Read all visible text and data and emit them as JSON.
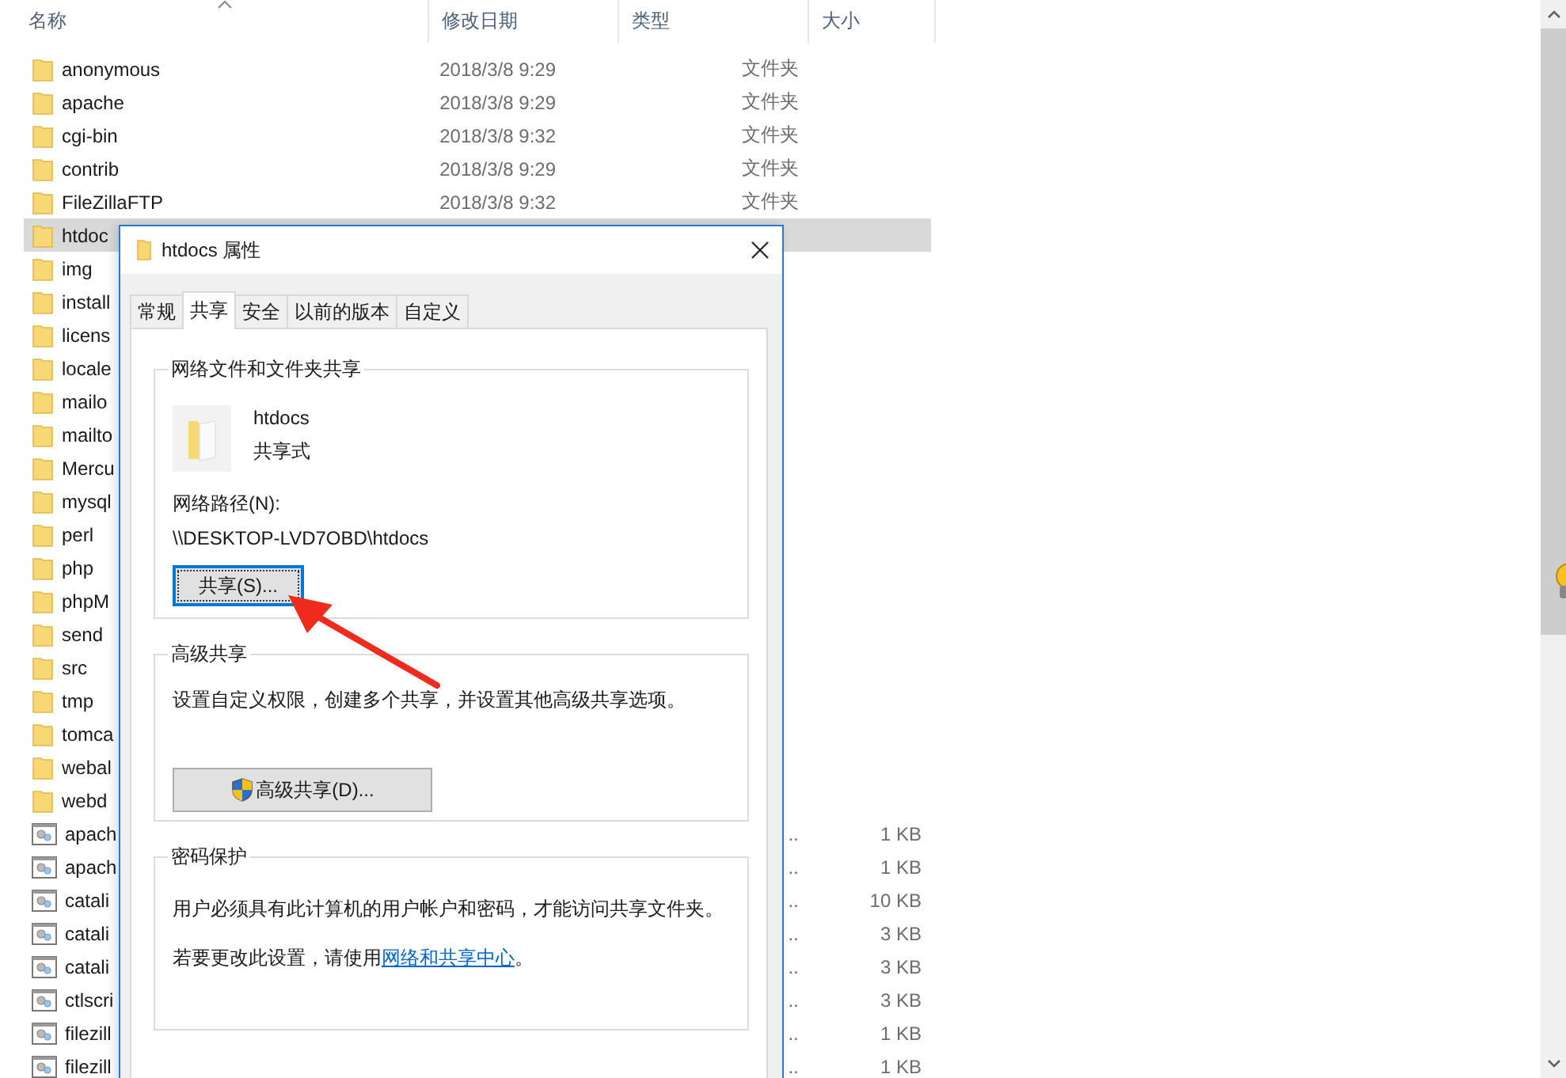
{
  "explorer": {
    "columns": [
      {
        "label": "名称",
        "sorted": true
      },
      {
        "label": "修改日期",
        "sorted": false
      },
      {
        "label": "类型",
        "sorted": false
      },
      {
        "label": "大小",
        "sorted": false
      }
    ],
    "rows": [
      {
        "kind": "folder",
        "name": "anonymous",
        "modified": "2018/3/8 9:29",
        "type": "文件夹",
        "selected": false
      },
      {
        "kind": "folder",
        "name": "apache",
        "modified": "2018/3/8 9:29",
        "type": "文件夹",
        "selected": false
      },
      {
        "kind": "folder",
        "name": "cgi-bin",
        "modified": "2018/3/8 9:32",
        "type": "文件夹",
        "selected": false
      },
      {
        "kind": "folder",
        "name": "contrib",
        "modified": "2018/3/8 9:29",
        "type": "文件夹",
        "selected": false
      },
      {
        "kind": "folder",
        "name": "FileZillaFTP",
        "modified": "2018/3/8 9:32",
        "type": "文件夹",
        "selected": false
      },
      {
        "kind": "folder",
        "name": "htdoc",
        "selected": true
      },
      {
        "kind": "folder",
        "name": "img",
        "selected": false
      },
      {
        "kind": "folder",
        "name": "install",
        "selected": false
      },
      {
        "kind": "folder",
        "name": "licens",
        "selected": false
      },
      {
        "kind": "folder",
        "name": "locale",
        "selected": false
      },
      {
        "kind": "folder",
        "name": "mailo",
        "selected": false
      },
      {
        "kind": "folder",
        "name": "mailto",
        "selected": false
      },
      {
        "kind": "folder",
        "name": "Mercu",
        "selected": false
      },
      {
        "kind": "folder",
        "name": "mysql",
        "selected": false
      },
      {
        "kind": "folder",
        "name": "perl",
        "selected": false
      },
      {
        "kind": "folder",
        "name": "php",
        "selected": false
      },
      {
        "kind": "folder",
        "name": "phpM",
        "selected": false
      },
      {
        "kind": "folder",
        "name": "send",
        "selected": false
      },
      {
        "kind": "folder",
        "name": "src",
        "selected": false
      },
      {
        "kind": "folder",
        "name": "tmp",
        "selected": false
      },
      {
        "kind": "folder",
        "name": "tomca",
        "selected": false
      },
      {
        "kind": "folder",
        "name": "webal",
        "selected": false
      },
      {
        "kind": "folder",
        "name": "webd",
        "selected": false
      },
      {
        "kind": "file",
        "name": "apach",
        "type": "..",
        "size": "1 KB",
        "selected": false
      },
      {
        "kind": "file",
        "name": "apach",
        "type": "..",
        "size": "1 KB",
        "selected": false
      },
      {
        "kind": "file",
        "name": "catali",
        "type": "..",
        "size": "10 KB",
        "selected": false
      },
      {
        "kind": "file",
        "name": "catali",
        "type": "..",
        "size": "3 KB",
        "selected": false
      },
      {
        "kind": "file",
        "name": "catali",
        "type": "..",
        "size": "3 KB",
        "selected": false
      },
      {
        "kind": "file",
        "name": "ctlscri",
        "type": "..",
        "size": "3 KB",
        "selected": false
      },
      {
        "kind": "file",
        "name": "filezill",
        "type": "..",
        "size": "1 KB",
        "selected": false
      },
      {
        "kind": "file",
        "name": "filezill",
        "type": "..",
        "size": "1 KB",
        "selected": false
      }
    ]
  },
  "dialog": {
    "title": "htdocs 属性",
    "tabs": [
      {
        "label": "常规",
        "selected": false
      },
      {
        "label": "共享",
        "selected": true
      },
      {
        "label": "安全",
        "selected": false
      },
      {
        "label": "以前的版本",
        "selected": false
      },
      {
        "label": "自定义",
        "selected": false
      }
    ],
    "network_sharing": {
      "heading": "网络文件和文件夹共享",
      "name": "htdocs",
      "status": "共享式",
      "path_label": "网络路径(N):",
      "path": "\\\\DESKTOP-LVD7OBD\\htdocs",
      "button": {
        "label": "共享(S)...",
        "focused": true
      }
    },
    "advanced_sharing": {
      "heading": "高级共享",
      "description": "设置自定义权限，创建多个共享，并设置其他高级共享选项。",
      "button": {
        "label": "高级共享(D)...",
        "focused": false
      }
    },
    "password_protection": {
      "heading": "密码保护",
      "description": "用户必须具有此计算机的用户帐户和密码，才能访问共享文件夹。",
      "note": "若要更改此设置，请使用",
      "link": "网络和共享中心",
      "note_end": "。"
    }
  }
}
